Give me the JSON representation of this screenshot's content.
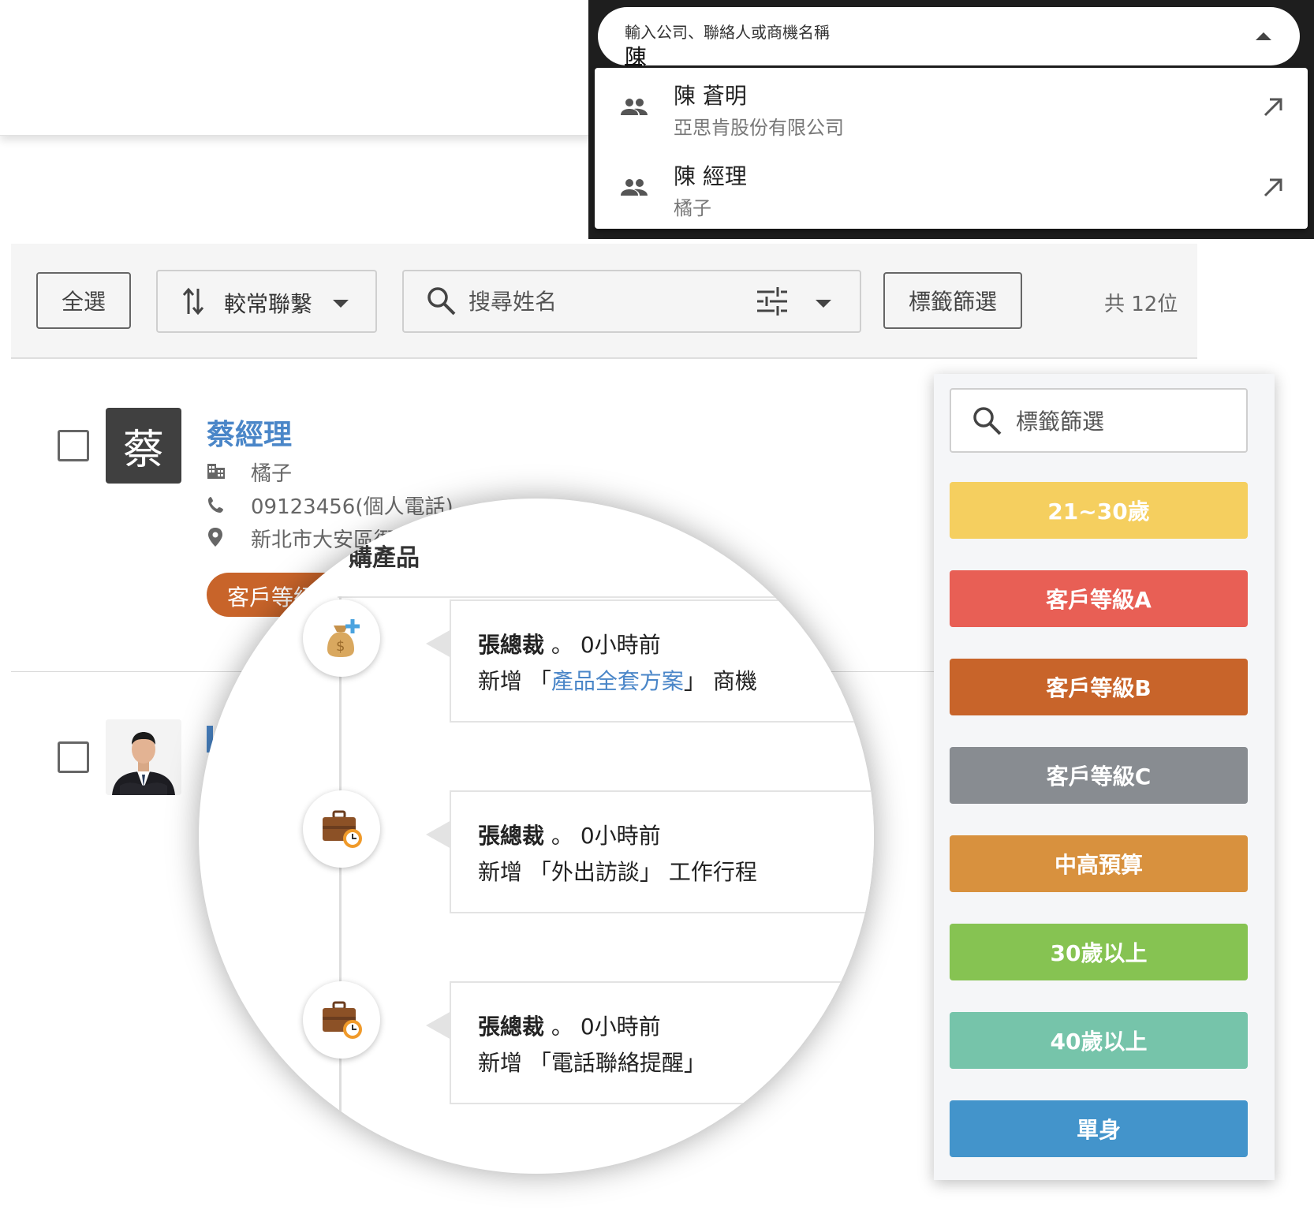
{
  "autocomplete": {
    "label": "輸入公司、聯絡人或商機名稱",
    "value": "陳",
    "results": [
      {
        "name": "陳 蒼明",
        "company": "亞思肯股份有限公司"
      },
      {
        "name": "陳 經理",
        "company": "橘子"
      }
    ]
  },
  "toolbar": {
    "select_all": "全選",
    "sort_label": "較常聯繫",
    "search_placeholder": "搜尋姓名",
    "tag_filter": "標籤篩選",
    "total": "共 12位"
  },
  "contacts": [
    {
      "avatar_char": "蔡",
      "name": "蔡經理",
      "company": "橘子",
      "phone": "09123456(個人電話)",
      "address": "新北市大安區衙",
      "tag": "客戶等級"
    }
  ],
  "magnifier": {
    "title": "購產品",
    "items": [
      {
        "actor": "張總裁",
        "time": "。 0小時前",
        "prefix": "新增 「",
        "item": "產品全套方案",
        "suffix": "」 商機"
      },
      {
        "actor": "張總裁",
        "time": "。 0小時前",
        "prefix": "新增 「",
        "item": "外出訪談",
        "suffix": "」 工作行程"
      },
      {
        "actor": "張總裁",
        "time": "。 0小時前",
        "prefix": "新增 「",
        "item": "電話聯絡提醒",
        "suffix": "」"
      }
    ]
  },
  "tag_panel": {
    "search_placeholder": "標籤篩選",
    "tags": [
      {
        "label": "21~30歲",
        "color": "#f5cf5f"
      },
      {
        "label": "客戶等級A",
        "color": "#e85f55"
      },
      {
        "label": "客戶等級B",
        "color": "#c8642a"
      },
      {
        "label": "客戶等級C",
        "color": "#888c91"
      },
      {
        "label": "中高預算",
        "color": "#d8913e"
      },
      {
        "label": "30歲以上",
        "color": "#86c352"
      },
      {
        "label": "40歲以上",
        "color": "#76c4aa"
      },
      {
        "label": "單身",
        "color": "#4394cb"
      }
    ]
  }
}
